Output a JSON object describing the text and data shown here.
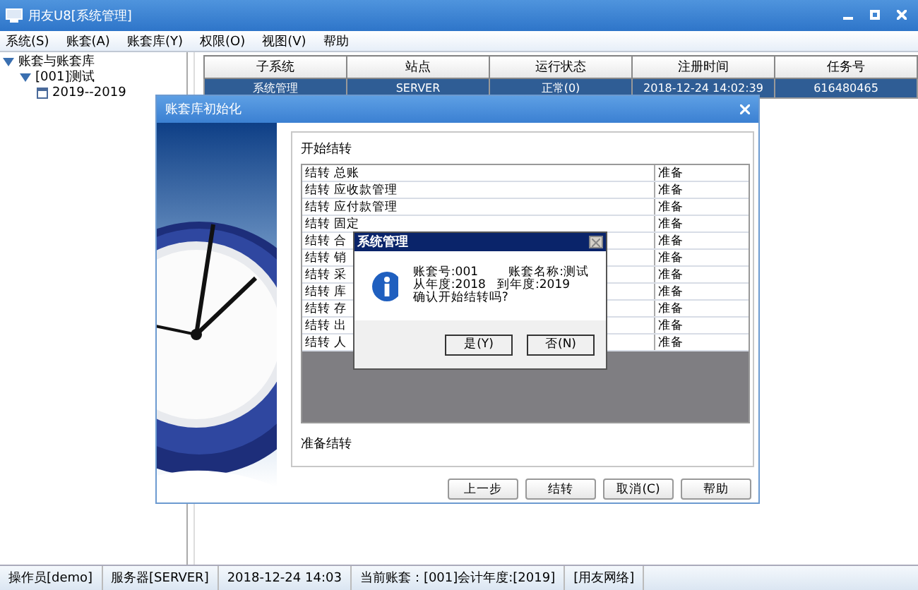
{
  "window": {
    "title": "用友U8[系统管理]"
  },
  "menu": [
    "系统(S)",
    "账套(A)",
    "账套库(Y)",
    "权限(O)",
    "视图(V)",
    "帮助"
  ],
  "tree": [
    {
      "label": "账套与账套库",
      "expanded": true,
      "children": [
        {
          "label": "[001]测试",
          "expanded": true,
          "children": [
            {
              "label": "2019--2019"
            }
          ]
        }
      ]
    }
  ],
  "table": {
    "columns": [
      "子系统",
      "站点",
      "运行状态",
      "注册时间",
      "任务号"
    ],
    "rows": [
      {
        "cells": [
          "系统管理",
          "SERVER",
          "正常(0)",
          "2018-12-24 14:02:39",
          "616480465"
        ],
        "selected": true
      }
    ]
  },
  "dialog": {
    "title": "账套库初始化",
    "heading": "开始结转",
    "rows": [
      {
        "task": "结转 总账",
        "status": "准备"
      },
      {
        "task": "结转 应收款管理",
        "status": "准备"
      },
      {
        "task": "结转 应付款管理",
        "status": "准备"
      },
      {
        "task": "结转 固定",
        "status": "准备"
      },
      {
        "task": "结转 合",
        "status": "准备"
      },
      {
        "task": "结转 销",
        "status": "准备"
      },
      {
        "task": "结转 采",
        "status": "准备"
      },
      {
        "task": "结转 库",
        "status": "准备"
      },
      {
        "task": "结转 存",
        "status": "准备"
      },
      {
        "task": "结转 出",
        "status": "准备"
      },
      {
        "task": "结转 人",
        "status": "准备"
      }
    ],
    "message": "准备结转",
    "buttons": [
      "上一步",
      "结转",
      "取消(C)",
      "帮助"
    ]
  },
  "message_box": {
    "title": "系统管理",
    "lines": [
      "账套号:001        账套名称:测试",
      "从年度:2018   到年度:2019",
      "确认开始结转吗?"
    ],
    "buttons": [
      "是(Y)",
      "否(N)"
    ]
  },
  "status_bar": [
    "操作员[demo]",
    "服务器[SERVER]",
    "2018-12-24 14:03",
    "当前账套：[001]会计年度:[2019]",
    "[用友网络]"
  ]
}
